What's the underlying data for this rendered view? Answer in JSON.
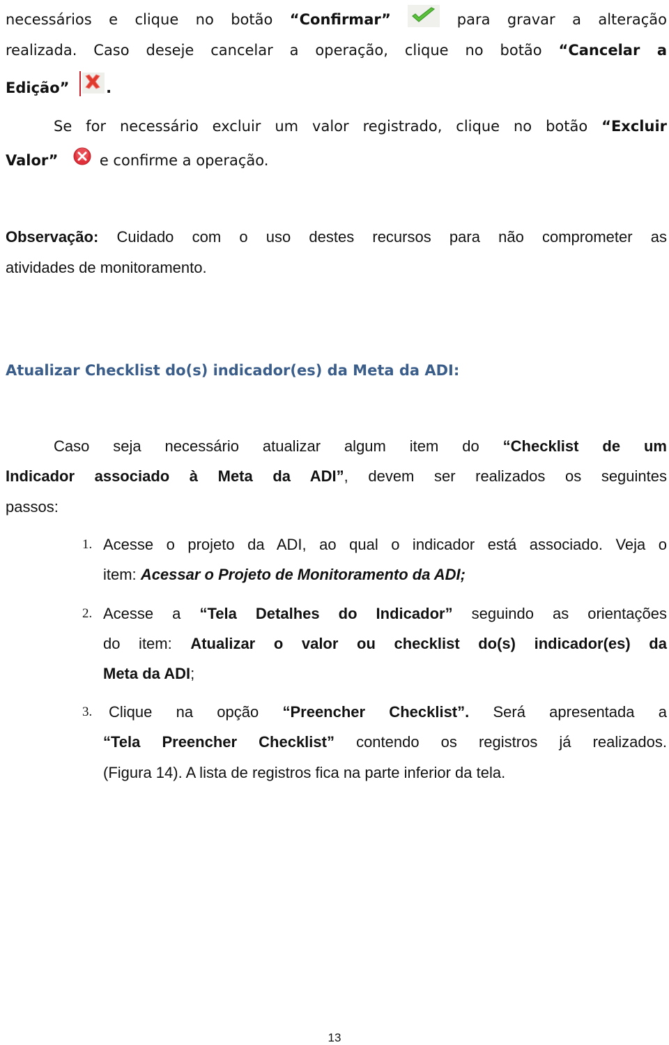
{
  "paragraph_confirm": {
    "line1_pre": "necessários e clique no botão",
    "confirm_label": "“Confirmar”",
    "line1_post": "para gravar a alteração",
    "line2_pre": "realizada. Caso deseje cancelar a operação, clique no botão",
    "cancel_label_part1": "“Cancelar a",
    "cancel_label_part2": "Edição”",
    "line3_post": "."
  },
  "paragraph_delete": {
    "line1_pre": "Se for necessário excluir um valor registrado, clique no botão",
    "delete_label_part1": "“Excluir",
    "delete_label_part2": "Valor”",
    "line2_post": "e confirme a operação."
  },
  "observation": {
    "label": "Observação:",
    "line1": "Cuidado com o uso destes recursos para não comprometer as",
    "line2": "atividades de monitoramento."
  },
  "section": {
    "heading": "Atualizar Checklist do(s) indicador(es) da Meta da ADI:",
    "intro_pre": "Caso seja necessário atualizar algum item do",
    "intro_bold1": "“Checklist de um",
    "intro_bold2": "Indicador associado à Meta da ADI”",
    "intro_post": ", devem ser realizados os seguintes",
    "intro_line3": "passos:"
  },
  "steps": [
    {
      "number": "1.",
      "line1": "Acesse o projeto da ADI, ao qual o indicador está associado. Veja o",
      "line2_pre": "item:",
      "line2_bold": "Acessar o Projeto de Monitoramento da ADI;"
    },
    {
      "number": "2.",
      "line1_pre": "Acesse a",
      "line1_bold": "“Tela Detalhes do Indicador”",
      "line1_post": "seguindo as orientações",
      "line2_pre": "do item:",
      "line2_bold": "Atualizar o valor ou checklist do(s) indicador(es) da",
      "line3_bold": "Meta da ADI",
      "line3_post": ";"
    },
    {
      "number": "3.",
      "line1_pre": "Clique na opção",
      "line1_bold": "“Preencher Checklist”.",
      "line1_post": "Será apresentada a",
      "line2_bold": "“Tela Preencher Checklist”",
      "line2_post": "contendo os registros já realizados.",
      "line3": "(Figura 14). A lista de registros fica na parte inferior da tela."
    }
  ],
  "icons": {
    "confirm": "check-icon",
    "cancel_edit": "cancel-x-icon",
    "delete_value": "delete-circle-icon"
  },
  "colors": {
    "heading": "#3a5d8a",
    "check_green": "#5cc23c",
    "cancel_red": "#e03a2c",
    "delete_red": "#e0303a"
  },
  "footer": {
    "page_number": "13"
  }
}
